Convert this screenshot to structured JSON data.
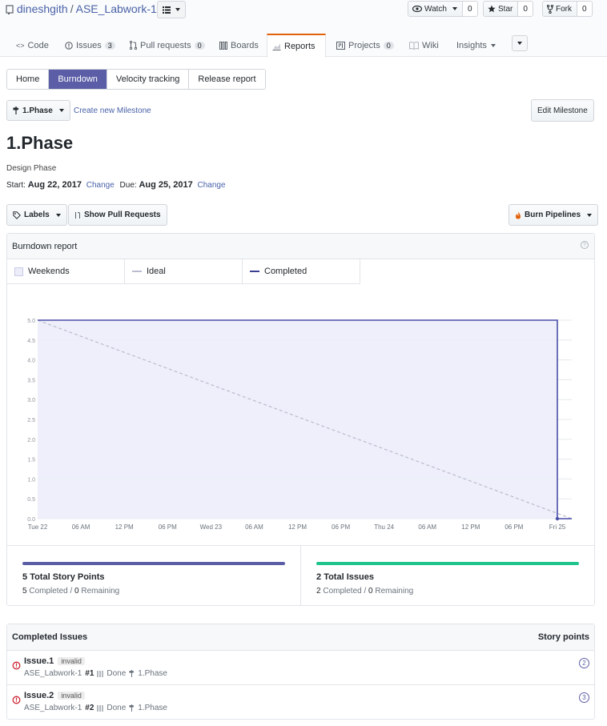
{
  "repo": {
    "owner": "dineshgith",
    "separator": "/",
    "name": "ASE_Labwork-1"
  },
  "header_buttons": {
    "watch": {
      "label": "Watch",
      "count": "0"
    },
    "star": {
      "label": "Star",
      "count": "0"
    },
    "fork": {
      "label": "Fork",
      "count": "0"
    }
  },
  "nav_tabs": [
    {
      "label": "Code",
      "icon": "code-icon"
    },
    {
      "label": "Issues",
      "count": "3",
      "icon": "issue-icon"
    },
    {
      "label": "Pull requests",
      "count": "0",
      "icon": "pull-request-icon"
    },
    {
      "label": "Boards",
      "icon": "boards-icon"
    },
    {
      "label": "Reports",
      "icon": "reports-icon",
      "active": true
    },
    {
      "label": "Projects",
      "count": "0",
      "icon": "projects-icon"
    },
    {
      "label": "Wiki",
      "icon": "wiki-icon"
    },
    {
      "label": "Insights",
      "icon": "caret-icon"
    }
  ],
  "report_tabs": [
    "Home",
    "Burndown",
    "Velocity tracking",
    "Release report"
  ],
  "report_tab_active": "Burndown",
  "milestone": {
    "selector_label": "1.Phase",
    "create_link": "Create new Milestone",
    "edit_button": "Edit Milestone",
    "title": "1.Phase",
    "description": "Design Phase",
    "start_label": "Start:",
    "start_date": "Aug 22, 2017",
    "due_label": "Due:",
    "due_date": "Aug 25, 2017",
    "change_link": "Change"
  },
  "filters": {
    "labels": "Labels",
    "show_prs": "Show Pull Requests",
    "pipelines": "Burn Pipelines"
  },
  "panel": {
    "title": "Burndown report"
  },
  "legend": {
    "weekends": "Weekends",
    "ideal": "Ideal",
    "completed": "Completed"
  },
  "colors": {
    "completed": "#4a4fa8",
    "ideal": "#b9bccf",
    "area": "#ecedf9",
    "issues_bar": "#1fc48d",
    "points_bar": "#5b5ea6",
    "accent_tab": "#e36209"
  },
  "chart_data": {
    "type": "line",
    "title": "",
    "x": [
      "Tue 22",
      "06 AM",
      "12 PM",
      "06 PM",
      "Wed 23",
      "06 AM",
      "12 PM",
      "06 PM",
      "Thu 24",
      "06 AM",
      "12 PM",
      "06 PM",
      "Fri 25"
    ],
    "ylim": [
      0,
      5
    ],
    "yticks": [
      "0.0",
      "0.5",
      "1.0",
      "1.5",
      "2.0",
      "2.5",
      "3.0",
      "3.5",
      "4.0",
      "4.5",
      "5.0"
    ],
    "series": [
      {
        "name": "Ideal",
        "x": [
          "Tue 22",
          "Fri 25"
        ],
        "y": [
          5,
          0
        ]
      },
      {
        "name": "Completed",
        "x": [
          "Tue 22",
          "Fri 25",
          "Fri 25"
        ],
        "y": [
          5,
          5,
          0
        ]
      }
    ],
    "grid": true,
    "legend": "top-left"
  },
  "stats": {
    "points": {
      "total": "5",
      "total_label": "Total Story Points",
      "completed": "5",
      "completed_label": "Completed",
      "remaining": "0",
      "remaining_label": "Remaining",
      "sep": "/"
    },
    "issues": {
      "total": "2",
      "total_label": "Total Issues",
      "completed": "2",
      "completed_label": "Completed",
      "remaining": "0",
      "remaining_label": "Remaining",
      "sep": "/"
    }
  },
  "completed_issues": {
    "heading": "Completed Issues",
    "points_heading": "Story points",
    "items": [
      {
        "title": "Issue.1",
        "tag": "invalid",
        "repo": "ASE_Labwork-1",
        "number": "#1",
        "pipeline": "Done",
        "milestone": "1.Phase",
        "points": "2"
      },
      {
        "title": "Issue.2",
        "tag": "invalid",
        "repo": "ASE_Labwork-1",
        "number": "#2",
        "pipeline": "Done",
        "milestone": "1.Phase",
        "points": "3"
      }
    ]
  }
}
